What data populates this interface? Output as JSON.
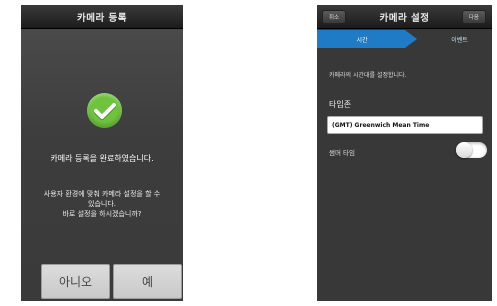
{
  "left_screen": {
    "title": "카메라 등록",
    "success_message": "카메라 등록을 완료하였습니다.",
    "prompt_lines": [
      "사용자 환경에 맞춰 카메라 설정을 할 수",
      "있습니다.",
      "바로 설정을 하시겠습니까?"
    ],
    "no_button": "아니오",
    "yes_button": "예",
    "accent_color": "#6fc33d"
  },
  "right_screen": {
    "title": "카메라 설정",
    "cancel_button": "취소",
    "next_button": "다음",
    "steps": [
      "시간",
      "이벤트"
    ],
    "active_step": 0,
    "description": "카메라의 시간대를 설정합니다.",
    "timezone_label": "타임존",
    "timezone_value": "(GMT) Greenwich Mean Time",
    "dst_label": "썸머 타임",
    "dst_enabled": false,
    "accent_color": "#1f7bc6"
  }
}
